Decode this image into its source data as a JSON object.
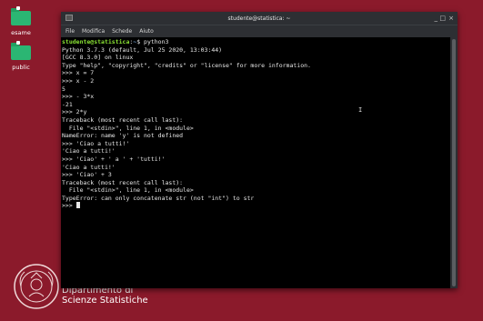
{
  "desktop": {
    "icons": [
      {
        "label": "esame"
      },
      {
        "label": "public"
      }
    ],
    "dept_line1": "Dipartimento di",
    "dept_line2": "Scienze Statistiche"
  },
  "window": {
    "title": "studente@statistica: ~",
    "controls": {
      "minimize": "_",
      "maximize": "□",
      "close": "×"
    },
    "menu": [
      "File",
      "Modifica",
      "Schede",
      "Aiuto"
    ]
  },
  "terminal": {
    "prompt_user": "studente@statistica",
    "prompt_sep": ":",
    "prompt_path": "~",
    "prompt_end": "$ ",
    "command": "python3",
    "lines": [
      "Python 3.7.3 (default, Jul 25 2020, 13:03:44)",
      "[GCC 8.3.0] on linux",
      "Type \"help\", \"copyright\", \"credits\" or \"license\" for more information.",
      ">>> x = 7",
      ">>> x - 2",
      "5",
      ">>> - 3*x",
      "-21",
      ">>> 2*y",
      "Traceback (most recent call last):",
      "  File \"<stdin>\", line 1, in <module>",
      "NameError: name 'y' is not defined",
      ">>> 'Ciao a tutti!'",
      "'Ciao a tutti!'",
      ">>> 'Ciao' + ' a ' + 'tutti!'",
      "'Ciao a tutti!'",
      ">>> 'Ciao' + 3",
      "Traceback (most recent call last):",
      "  File \"<stdin>\", line 1, in <module>",
      "TypeError: can only concatenate str (not \"int\") to str"
    ],
    "last_prompt": ">>> "
  },
  "colors": {
    "desktop_bg": "#8b1a2b",
    "folder": "#2bb673",
    "prompt_user": "#8ae234",
    "prompt_path": "#729fcf",
    "terminal_bg": "#000000"
  }
}
